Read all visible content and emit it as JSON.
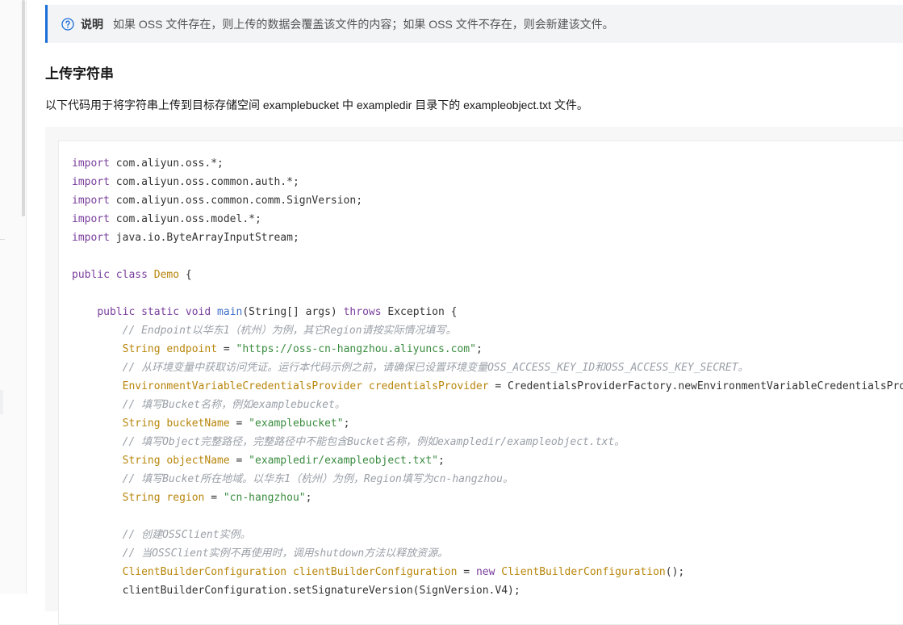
{
  "note": {
    "icon": "question-circle-icon",
    "title": "说明",
    "text": "如果 OSS 文件存在，则上传的数据会覆盖该文件的内容；如果 OSS 文件不存在，则会新建该文件。"
  },
  "section": {
    "title": "上传字符串",
    "description": "以下代码用于将字符串上传到目标存储空间 examplebucket 中 exampledir 目录下的 exampleobject.txt 文件。"
  },
  "code_lines": [
    [
      [
        "kw",
        "import"
      ],
      [
        "pun",
        " com.aliyun.oss.*;"
      ]
    ],
    [
      [
        "kw",
        "import"
      ],
      [
        "pun",
        " com.aliyun.oss.common.auth.*;"
      ]
    ],
    [
      [
        "kw",
        "import"
      ],
      [
        "pun",
        " com.aliyun.oss.common.comm.SignVersion;"
      ]
    ],
    [
      [
        "kw",
        "import"
      ],
      [
        "pun",
        " com.aliyun.oss.model.*;"
      ]
    ],
    [
      [
        "kw",
        "import"
      ],
      [
        "pun",
        " java.io.ByteArrayInputStream;"
      ]
    ],
    [],
    [
      [
        "kw",
        "public"
      ],
      [
        "pun",
        " "
      ],
      [
        "kw",
        "class"
      ],
      [
        "pun",
        " "
      ],
      [
        "cls",
        "Demo"
      ],
      [
        "pun",
        " {"
      ]
    ],
    [],
    [
      [
        "pun",
        "    "
      ],
      [
        "kw",
        "public"
      ],
      [
        "pun",
        " "
      ],
      [
        "kw",
        "static"
      ],
      [
        "pun",
        " "
      ],
      [
        "kw",
        "void"
      ],
      [
        "pun",
        " "
      ],
      [
        "fn",
        "main"
      ],
      [
        "pun",
        "(String[] args) "
      ],
      [
        "kw",
        "throws"
      ],
      [
        "pun",
        " Exception {"
      ]
    ],
    [
      [
        "pun",
        "        "
      ],
      [
        "cmt",
        "// Endpoint以华东1（杭州）为例，其它Region请按实际情况填写。"
      ]
    ],
    [
      [
        "pun",
        "        "
      ],
      [
        "var",
        "String endpoint"
      ],
      [
        "pun",
        " = "
      ],
      [
        "str",
        "\"https://oss-cn-hangzhou.aliyuncs.com\""
      ],
      [
        "pun",
        ";"
      ]
    ],
    [
      [
        "pun",
        "        "
      ],
      [
        "cmt",
        "// 从环境变量中获取访问凭证。运行本代码示例之前，请确保已设置环境变量OSS_ACCESS_KEY_ID和OSS_ACCESS_KEY_SECRET。"
      ]
    ],
    [
      [
        "pun",
        "        "
      ],
      [
        "var",
        "EnvironmentVariableCredentialsProvider credentialsProvider"
      ],
      [
        "pun",
        " = CredentialsProviderFactory.newEnvironmentVariableCredentialsProvi"
      ]
    ],
    [
      [
        "pun",
        "        "
      ],
      [
        "cmt",
        "// 填写Bucket名称，例如examplebucket。"
      ]
    ],
    [
      [
        "pun",
        "        "
      ],
      [
        "var",
        "String bucketName"
      ],
      [
        "pun",
        " = "
      ],
      [
        "str",
        "\"examplebucket\""
      ],
      [
        "pun",
        ";"
      ]
    ],
    [
      [
        "pun",
        "        "
      ],
      [
        "cmt",
        "// 填写Object完整路径，完整路径中不能包含Bucket名称，例如exampledir/exampleobject.txt。"
      ]
    ],
    [
      [
        "pun",
        "        "
      ],
      [
        "var",
        "String objectName"
      ],
      [
        "pun",
        " = "
      ],
      [
        "str",
        "\"exampledir/exampleobject.txt\""
      ],
      [
        "pun",
        ";"
      ]
    ],
    [
      [
        "pun",
        "        "
      ],
      [
        "cmt",
        "// 填写Bucket所在地域。以华东1（杭州）为例，Region填写为cn-hangzhou。"
      ]
    ],
    [
      [
        "pun",
        "        "
      ],
      [
        "var",
        "String region"
      ],
      [
        "pun",
        " = "
      ],
      [
        "str",
        "\"cn-hangzhou\""
      ],
      [
        "pun",
        ";"
      ]
    ],
    [],
    [
      [
        "pun",
        "        "
      ],
      [
        "cmt",
        "// 创建OSSClient实例。"
      ]
    ],
    [
      [
        "pun",
        "        "
      ],
      [
        "cmt",
        "// 当OSSClient实例不再使用时，调用shutdown方法以释放资源。"
      ]
    ],
    [
      [
        "pun",
        "        "
      ],
      [
        "var",
        "ClientBuilderConfiguration clientBuilderConfiguration"
      ],
      [
        "pun",
        " = "
      ],
      [
        "kw",
        "new"
      ],
      [
        "pun",
        " "
      ],
      [
        "cls",
        "ClientBuilderConfiguration"
      ],
      [
        "pun",
        "();"
      ]
    ],
    [
      [
        "pun",
        "        clientBuilderConfiguration.setSignatureVersion(SignVersion.V4);"
      ]
    ]
  ]
}
